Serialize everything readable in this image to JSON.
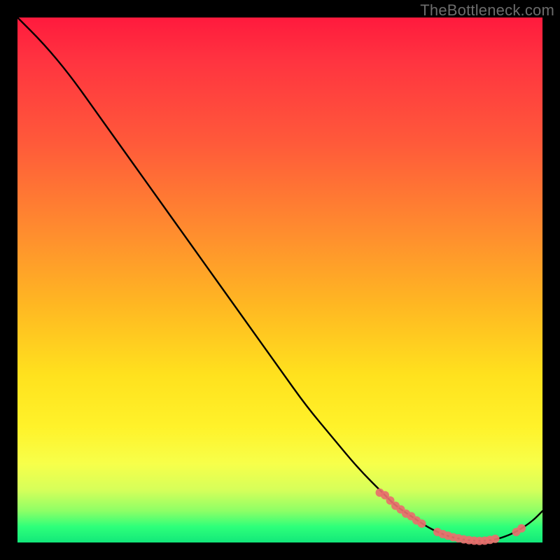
{
  "watermark": "TheBottleneck.com",
  "chart_data": {
    "type": "line",
    "title": "",
    "xlabel": "",
    "ylabel": "",
    "xlim": [
      0,
      100
    ],
    "ylim": [
      0,
      100
    ],
    "grid": false,
    "legend": false,
    "series": [
      {
        "name": "curve",
        "color": "#000000",
        "x": [
          0,
          5,
          10,
          15,
          20,
          25,
          30,
          35,
          40,
          45,
          50,
          55,
          60,
          65,
          70,
          72,
          75,
          78,
          80,
          82,
          85,
          88,
          90,
          92,
          95,
          98,
          100
        ],
        "y": [
          100,
          95,
          89,
          82,
          75,
          68,
          61,
          54,
          47,
          40,
          33,
          26,
          20,
          14,
          9,
          7,
          5,
          3,
          2,
          1.2,
          0.5,
          0.3,
          0.4,
          0.8,
          2,
          4,
          6
        ]
      }
    ],
    "markers": [
      {
        "name": "highlight-descent",
        "shape": "circle",
        "color": "#e86f6d",
        "radius": 6,
        "points": [
          {
            "x": 69,
            "y": 9.5
          },
          {
            "x": 70,
            "y": 9.0
          },
          {
            "x": 71,
            "y": 8.0
          },
          {
            "x": 72,
            "y": 7.0
          },
          {
            "x": 73,
            "y": 6.3
          },
          {
            "x": 74,
            "y": 5.5
          },
          {
            "x": 75,
            "y": 5.0
          },
          {
            "x": 76,
            "y": 4.2
          },
          {
            "x": 77,
            "y": 3.6
          }
        ]
      },
      {
        "name": "highlight-valley",
        "shape": "circle",
        "color": "#e86f6d",
        "radius": 6,
        "points": [
          {
            "x": 80,
            "y": 2.0
          },
          {
            "x": 81,
            "y": 1.6
          },
          {
            "x": 82,
            "y": 1.3
          },
          {
            "x": 83,
            "y": 1.0
          },
          {
            "x": 84,
            "y": 0.8
          },
          {
            "x": 85,
            "y": 0.6
          },
          {
            "x": 86,
            "y": 0.45
          },
          {
            "x": 87,
            "y": 0.35
          },
          {
            "x": 88,
            "y": 0.3
          },
          {
            "x": 89,
            "y": 0.35
          },
          {
            "x": 90,
            "y": 0.5
          },
          {
            "x": 91,
            "y": 0.7
          }
        ]
      },
      {
        "name": "highlight-ascent",
        "shape": "circle",
        "color": "#e86f6d",
        "radius": 6,
        "points": [
          {
            "x": 95,
            "y": 2.0
          },
          {
            "x": 96,
            "y": 2.7
          }
        ]
      }
    ]
  }
}
